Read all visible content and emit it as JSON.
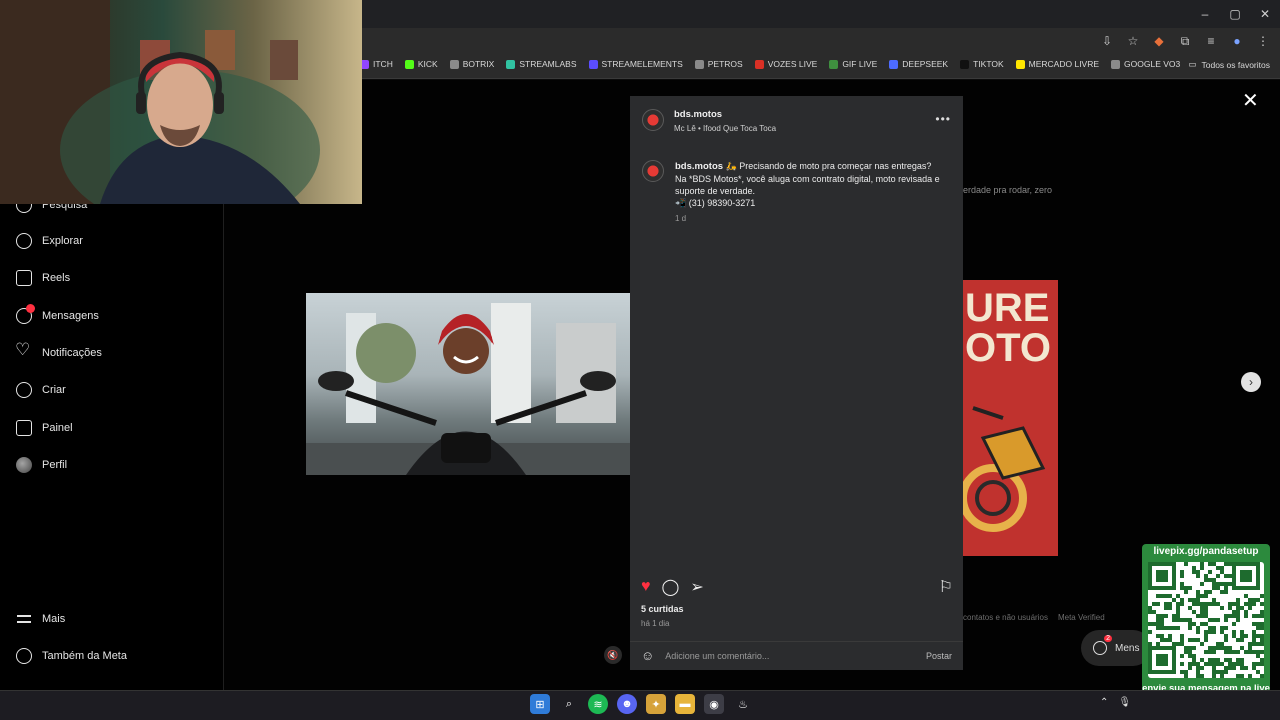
{
  "browser": {
    "window_controls": [
      "–",
      "▢",
      "✕"
    ],
    "bookmarks": [
      {
        "label": "ITCH",
        "color": "#9146ff"
      },
      {
        "label": "KICK",
        "color": "#53fc18"
      },
      {
        "label": "BOTRIX",
        "color": "#8a8a8a"
      },
      {
        "label": "STREAMLABS",
        "color": "#31c3a2"
      },
      {
        "label": "STREAMELEMENTS",
        "color": "#5b4dff"
      },
      {
        "label": "PETROS",
        "color": "#8a8a8a"
      },
      {
        "label": "VOZES LIVE",
        "color": "#d93025"
      },
      {
        "label": "GIF LIVE",
        "color": "#3f8f3f"
      },
      {
        "label": "DEEPSEEK",
        "color": "#4d6bfe"
      },
      {
        "label": "TIKTOK",
        "color": "#111111"
      },
      {
        "label": "MERCADO LIVRE",
        "color": "#ffe600"
      },
      {
        "label": "GOOGLE VO3",
        "color": "#8a8a8a"
      }
    ],
    "all_favorites": "Todos os favoritos"
  },
  "sidebar": {
    "items": [
      {
        "label": "Pesquisa",
        "icon": "search-icon"
      },
      {
        "label": "Explorar",
        "icon": "compass-icon"
      },
      {
        "label": "Reels",
        "icon": "reels-icon"
      },
      {
        "label": "Mensagens",
        "icon": "messenger-icon"
      },
      {
        "label": "Notificações",
        "icon": "heart-icon"
      },
      {
        "label": "Criar",
        "icon": "plus-icon"
      },
      {
        "label": "Painel",
        "icon": "chart-icon"
      },
      {
        "label": "Perfil",
        "icon": "avatar"
      },
      {
        "label": "Mais",
        "icon": "menu-icon"
      },
      {
        "label": "Também da Meta",
        "icon": "meta-icon"
      }
    ]
  },
  "background": {
    "text_fragment": "erdade pra rodar, zero",
    "poster_text": [
      "URE",
      "OTO"
    ],
    "footer_links": [
      "contatos e não usuários",
      "Meta Verified"
    ],
    "messages_pill": "Mens",
    "messages_pill_badge": "2"
  },
  "post": {
    "username": "bds.motos",
    "audio": "Mc Lê • Ifood Que Toca Toca",
    "caption_user": "bds.motos",
    "caption_lines": [
      "Precisando de moto pra começar nas entregas?",
      "Na *BDS Motos*, você aluga com contrato digital, moto revisada e",
      "suporte de verdade.",
      "(31) 98390-3271"
    ],
    "caption_time": "1 d",
    "likes": "5 curtidas",
    "date": "há 1 dia",
    "comment_placeholder": "Adicione um comentário...",
    "post_button": "Postar",
    "like_color": "#ff3040"
  },
  "pix": {
    "top_text": "livepix.gg/pandasetup",
    "bottom_text": "envie sua mensagem na live via pix!"
  }
}
